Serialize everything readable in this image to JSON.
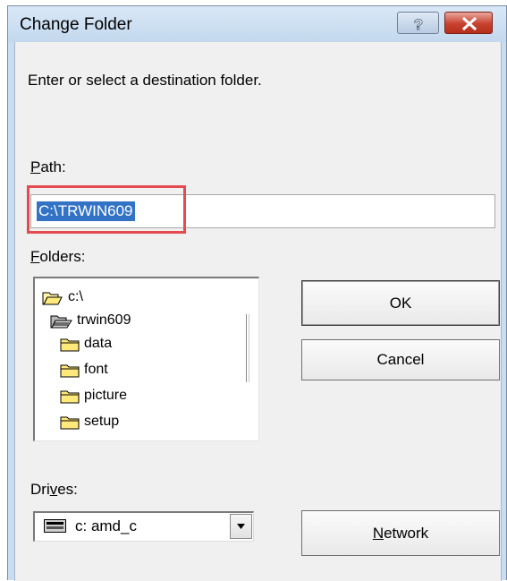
{
  "window": {
    "title": "Change Folder"
  },
  "titlebar_buttons": {
    "help": "?",
    "close": "✕"
  },
  "instruction": "Enter or select a destination folder.",
  "path": {
    "label_mnemonic": "P",
    "label_rest": "ath:",
    "value": "C:\\TRWIN609"
  },
  "folders": {
    "label_mnemonic": "F",
    "label_rest": "olders:",
    "items": [
      {
        "name": "c:\\",
        "icon": "open-folder-icon"
      },
      {
        "name": "trwin609",
        "icon": "open-folder-icon"
      },
      {
        "name": "data",
        "icon": "folder-icon"
      },
      {
        "name": "font",
        "icon": "folder-icon"
      },
      {
        "name": "picture",
        "icon": "folder-icon"
      },
      {
        "name": "setup",
        "icon": "folder-icon"
      }
    ]
  },
  "buttons": {
    "ok": "OK",
    "cancel": "Cancel",
    "network_mnemonic": "N",
    "network_rest": "etwork"
  },
  "drives": {
    "label_pre": "Dri",
    "label_mnemonic": "v",
    "label_post": "es:",
    "selected": "c: amd_c",
    "icon": "drive-icon"
  },
  "colors": {
    "selection": "#3373c6",
    "highlight_box": "#e44a4f",
    "close_button": "#c8412f"
  }
}
